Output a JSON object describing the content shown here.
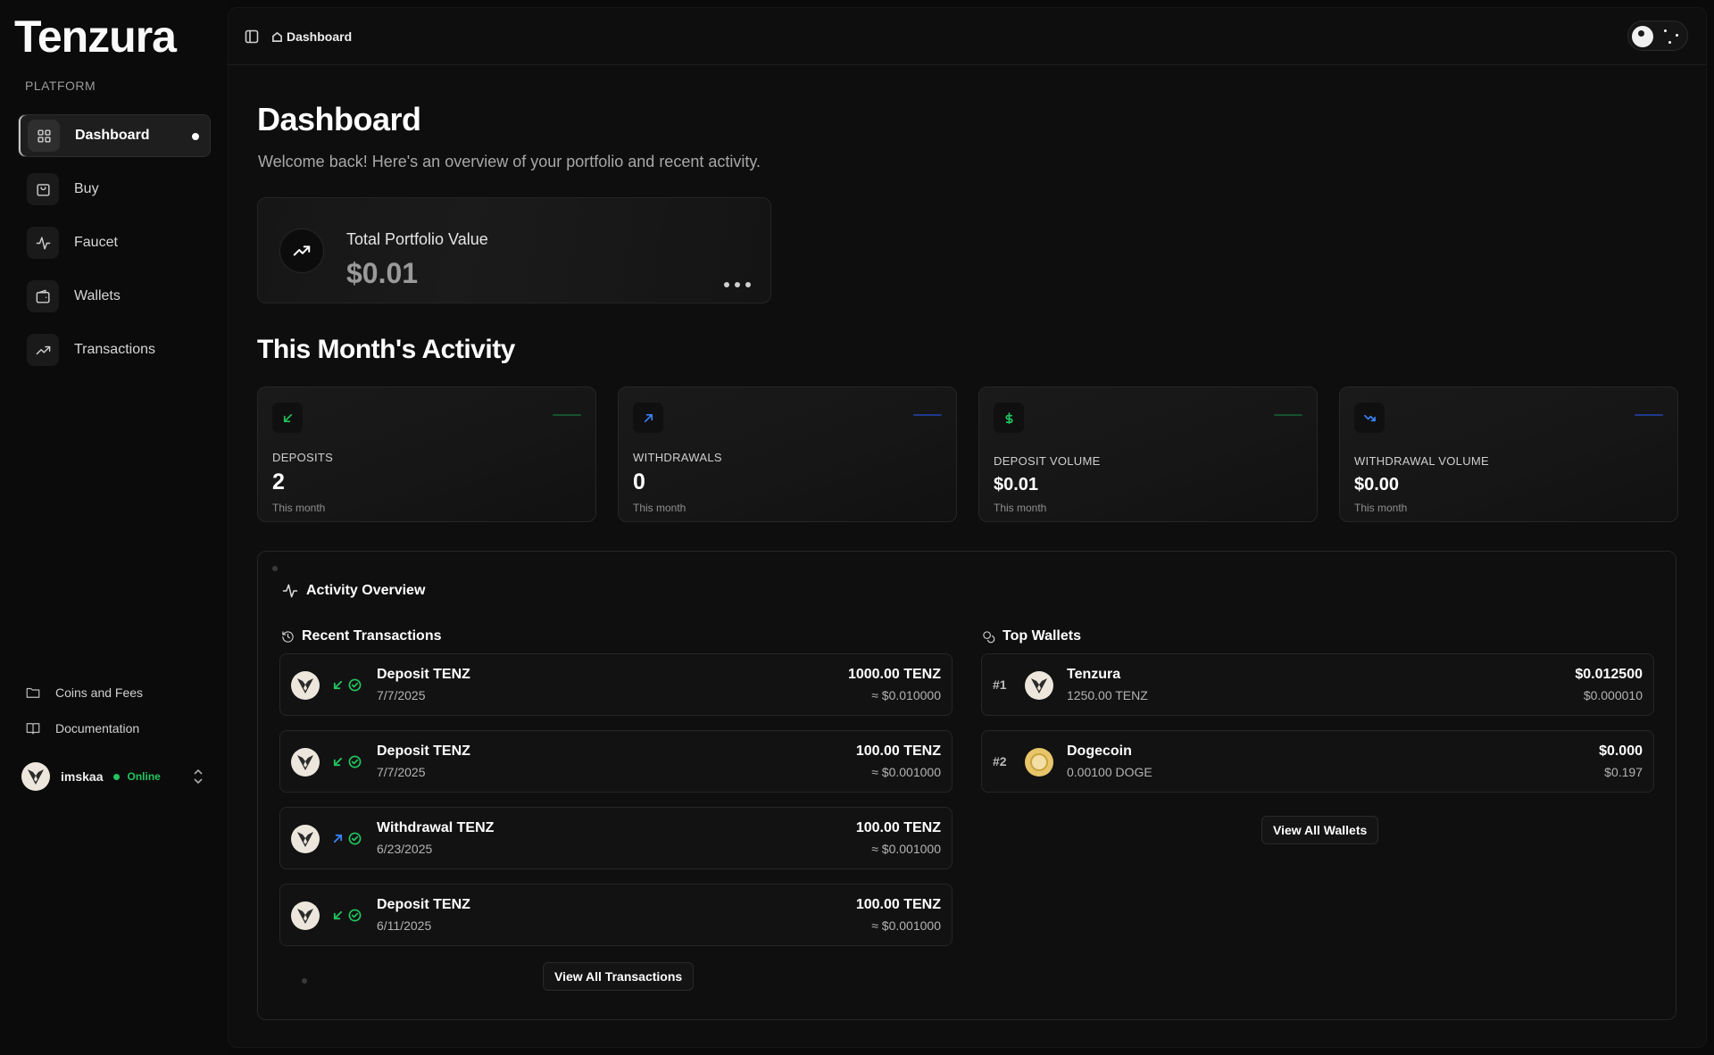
{
  "brand": {
    "name": "Tenzura"
  },
  "sidebar": {
    "section_label": "PLATFORM",
    "items": [
      {
        "label": "Dashboard",
        "icon": "grid-icon",
        "active": true
      },
      {
        "label": "Buy",
        "icon": "shopping-bag-icon"
      },
      {
        "label": "Faucet",
        "icon": "activity-icon"
      },
      {
        "label": "Wallets",
        "icon": "wallet-icon"
      },
      {
        "label": "Transactions",
        "icon": "trending-up-icon"
      }
    ],
    "footer_links": [
      {
        "label": "Coins and Fees",
        "icon": "folder-icon"
      },
      {
        "label": "Documentation",
        "icon": "book-icon"
      }
    ],
    "user": {
      "name": "imskaa",
      "status": "Online"
    }
  },
  "topbar": {
    "breadcrumb": "Dashboard"
  },
  "page": {
    "title": "Dashboard",
    "subtitle": "Welcome back! Here's an overview of your portfolio and recent activity."
  },
  "portfolio": {
    "label": "Total Portfolio Value",
    "value": "$0.01"
  },
  "activity": {
    "title": "This Month's Activity",
    "stats": [
      {
        "label": "DEPOSITS",
        "value": "2",
        "sub": "This month",
        "accent": "#22c55e",
        "icon": "arrow-down-left-icon"
      },
      {
        "label": "WITHDRAWALS",
        "value": "0",
        "sub": "This month",
        "accent": "#3b82f6",
        "icon": "arrow-up-right-icon"
      },
      {
        "label": "DEPOSIT VOLUME",
        "value": "$0.01",
        "sub": "This month",
        "accent": "#22c55e",
        "icon": "dollar-icon"
      },
      {
        "label": "WITHDRAWAL VOLUME",
        "value": "$0.00",
        "sub": "This month",
        "accent": "#3b82f6",
        "icon": "trending-down-icon"
      }
    ]
  },
  "overview": {
    "title": "Activity Overview",
    "recent_title": "Recent Transactions",
    "transactions": [
      {
        "name": "Deposit TENZ",
        "date": "7/7/2025",
        "amount": "1000.00 TENZ",
        "usd": "≈ $0.010000",
        "direction": "in"
      },
      {
        "name": "Deposit TENZ",
        "date": "7/7/2025",
        "amount": "100.00 TENZ",
        "usd": "≈ $0.001000",
        "direction": "in"
      },
      {
        "name": "Withdrawal TENZ",
        "date": "6/23/2025",
        "amount": "100.00 TENZ",
        "usd": "≈ $0.001000",
        "direction": "out"
      },
      {
        "name": "Deposit TENZ",
        "date": "6/11/2025",
        "amount": "100.00 TENZ",
        "usd": "≈ $0.001000",
        "direction": "in"
      }
    ],
    "view_all_transactions": "View All Transactions",
    "wallets_title": "Top Wallets",
    "wallets": [
      {
        "rank": "#1",
        "name": "Tenzura",
        "balance": "1250.00 TENZ",
        "value": "$0.012500",
        "sub_value": "$0.000010",
        "coin": "tenz"
      },
      {
        "rank": "#2",
        "name": "Dogecoin",
        "balance": "0.00100 DOGE",
        "value": "$0.000",
        "sub_value": "$0.197",
        "coin": "doge"
      }
    ],
    "view_all_wallets": "View All Wallets"
  }
}
